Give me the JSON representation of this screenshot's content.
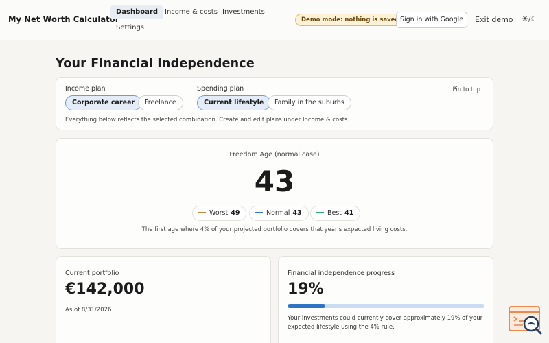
{
  "header": {
    "brand": "My Net Worth Calculator",
    "nav": [
      "Dashboard",
      "Income & costs",
      "Investments",
      "Settings"
    ],
    "active_nav": "Dashboard",
    "demo_badge": "Demo mode: nothing is saved",
    "sign_in": "Sign in with Google",
    "exit_demo": "Exit demo",
    "theme_toggle": "☀/☾"
  },
  "main": {
    "title": "Your Financial Independence",
    "plans": {
      "income_label": "Income plan",
      "income_options": [
        "Corporate career",
        "Freelance"
      ],
      "income_selected": "Corporate career",
      "spending_label": "Spending plan",
      "spending_options": [
        "Current lifestyle",
        "Family in the suburbs"
      ],
      "spending_selected": "Current lifestyle",
      "pin": "Pin to top",
      "note": "Everything below reflects the selected combination. Create and edit plans under Income & costs."
    },
    "freedom": {
      "label": "Freedom Age (normal case)",
      "age": "43",
      "scenarios": [
        {
          "name": "Worst",
          "value": "49",
          "color": "#c9853a"
        },
        {
          "name": "Normal",
          "value": "43",
          "color": "#2f73c4"
        },
        {
          "name": "Best",
          "value": "41",
          "color": "#2aa97a"
        }
      ],
      "note": "The first age where 4% of your projected portfolio covers that year's expected living costs."
    },
    "portfolio": {
      "label": "Current portfolio",
      "value": "€142,000",
      "as_of": "As of 8/31/2026"
    },
    "progress": {
      "label": "Financial independence progress",
      "value": "19%",
      "fraction": 0.19,
      "note": "Your investments could currently cover approximately 19% of your expected lifestyle using the 4% rule."
    }
  },
  "colors": {
    "accent": "#2f73c4",
    "badge_bg": "#fdf1d6",
    "badge_border": "#e8b860"
  }
}
